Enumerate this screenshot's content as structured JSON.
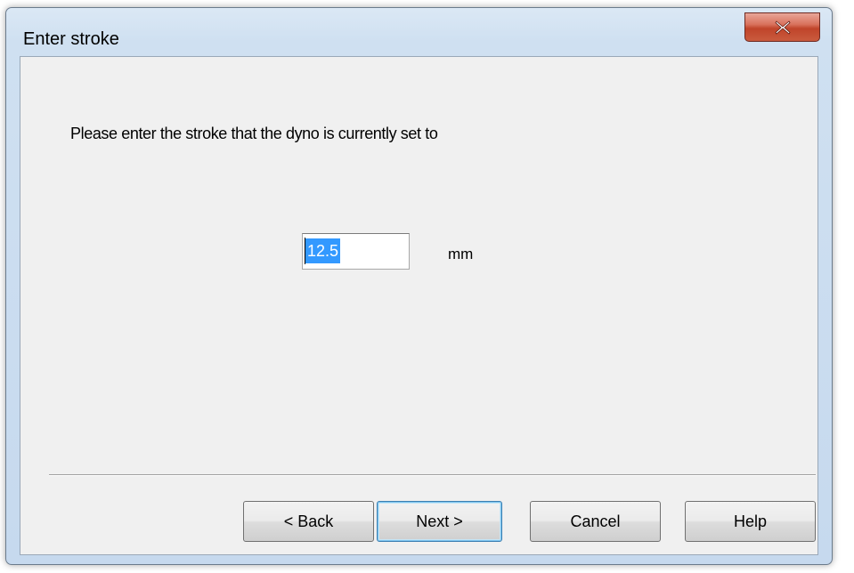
{
  "window": {
    "title": "Enter stroke"
  },
  "titlebar": {
    "close_icon": "close-x-icon",
    "close_color": "#c7472d"
  },
  "content": {
    "prompt": "Please enter the stroke that the dyno is currently set to",
    "stroke_value": "12.5",
    "stroke_unit": "mm"
  },
  "buttons": {
    "back_label": "< Back",
    "next_label": "Next >",
    "cancel_label": "Cancel",
    "help_label": "Help"
  }
}
